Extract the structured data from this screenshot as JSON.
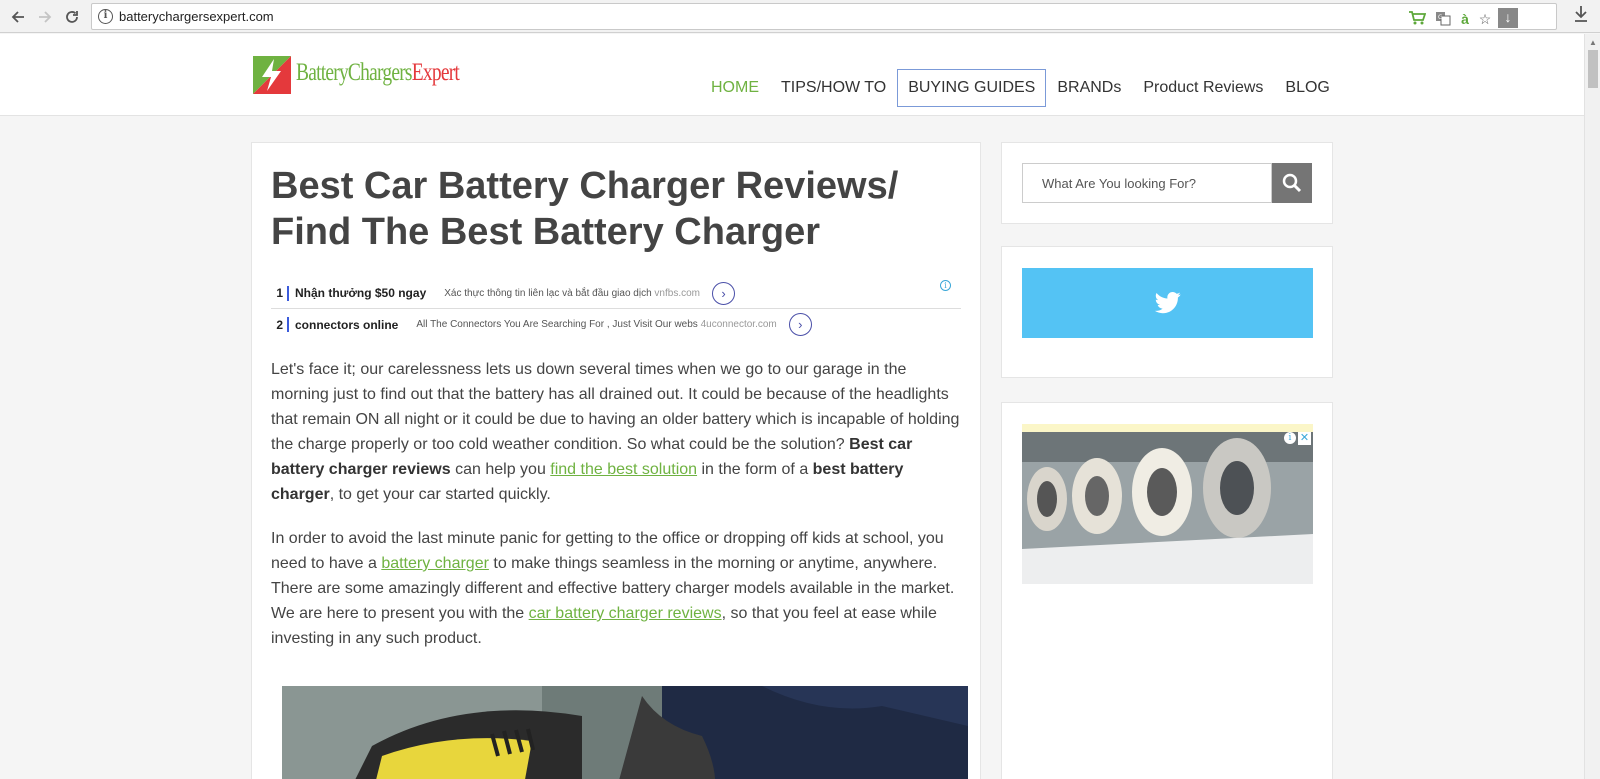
{
  "browser": {
    "url": "batterychargersexpert.com",
    "back_icon": "arrow-left-icon",
    "forward_icon": "arrow-right-icon",
    "reload_icon": "reload-icon"
  },
  "site": {
    "logo_text_green": "BatteryChargers",
    "logo_text_red": "Expert",
    "brand_green": "#6fb241",
    "brand_red": "#e4393c",
    "nav": [
      {
        "label": "HOME",
        "active": true
      },
      {
        "label": "TIPS/HOW TO"
      },
      {
        "label": "BUYING GUIDES",
        "focused": true
      },
      {
        "label": "BRANDs"
      },
      {
        "label": "Product Reviews"
      },
      {
        "label": "BLOG"
      }
    ]
  },
  "post": {
    "title": "Best Car Battery Charger Reviews/ Find The Best Battery Charger",
    "ads": [
      {
        "num": "1",
        "title": "Nhận thưởng $50 ngay",
        "desc": "Xác thực thông tin liên lạc và bắt đầu giao dịch",
        "host": "vnfbs.com"
      },
      {
        "num": "2",
        "title": "connectors online",
        "desc": "All The Connectors You Are Searching For , Just Visit Our webs",
        "host": "4uconnector.com"
      }
    ],
    "p1": {
      "t1": "Let's face it; our carelessness lets us down several times when we go to our garage in the morning just to find out that the battery has all drained out. It could be because of the headlights that remain ON all night or it could be due to having an older battery which is incapable of holding the charge properly or too cold weather condition. So what could be the solution? ",
      "b1": "Best car battery charger reviews",
      "t2": " can help you ",
      "link1": "find the best solution",
      "t3": " in the form of a ",
      "b2": "best battery charger",
      "t4": ", to get your car started quickly."
    },
    "p2": {
      "t1": "In order to avoid the last minute panic for getting to the office or dropping off kids at school, you need to have a ",
      "link1": "battery charger",
      "t2": " to make things seamless in the morning or anytime, anywhere. There are some amazingly different and effective battery charger models available in the market. We are here to present you with the ",
      "link2": "car battery charger reviews",
      "t3": ", so that you feel at ease while investing in any such product."
    }
  },
  "sidebar": {
    "search_placeholder": "What Are You looking For?",
    "search_icon": "search-icon",
    "twitter_icon": "twitter-icon",
    "twitter_color": "#54c3f4"
  }
}
